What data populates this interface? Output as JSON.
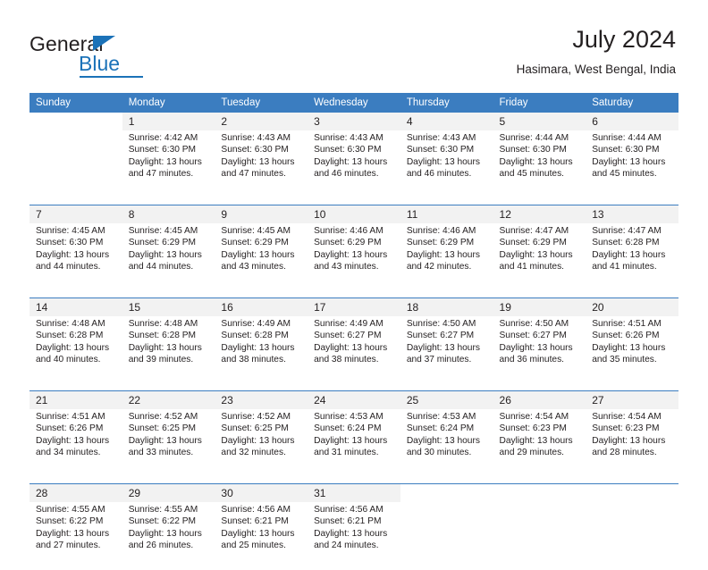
{
  "brand": {
    "name_dark": "General",
    "name_blue": "Blue",
    "accent_color": "#1b72b8"
  },
  "header": {
    "title": "July 2024",
    "subtitle": "Hasimara, West Bengal, India"
  },
  "calendar": {
    "header_bg": "#3b7dc0",
    "daynum_bg": "#f2f2f2",
    "weekdays": [
      "Sunday",
      "Monday",
      "Tuesday",
      "Wednesday",
      "Thursday",
      "Friday",
      "Saturday"
    ],
    "weeks": [
      [
        {
          "day": "",
          "sunrise": "",
          "sunset": "",
          "daylight_1": "",
          "daylight_2": ""
        },
        {
          "day": "1",
          "sunrise": "Sunrise: 4:42 AM",
          "sunset": "Sunset: 6:30 PM",
          "daylight_1": "Daylight: 13 hours",
          "daylight_2": "and 47 minutes."
        },
        {
          "day": "2",
          "sunrise": "Sunrise: 4:43 AM",
          "sunset": "Sunset: 6:30 PM",
          "daylight_1": "Daylight: 13 hours",
          "daylight_2": "and 47 minutes."
        },
        {
          "day": "3",
          "sunrise": "Sunrise: 4:43 AM",
          "sunset": "Sunset: 6:30 PM",
          "daylight_1": "Daylight: 13 hours",
          "daylight_2": "and 46 minutes."
        },
        {
          "day": "4",
          "sunrise": "Sunrise: 4:43 AM",
          "sunset": "Sunset: 6:30 PM",
          "daylight_1": "Daylight: 13 hours",
          "daylight_2": "and 46 minutes."
        },
        {
          "day": "5",
          "sunrise": "Sunrise: 4:44 AM",
          "sunset": "Sunset: 6:30 PM",
          "daylight_1": "Daylight: 13 hours",
          "daylight_2": "and 45 minutes."
        },
        {
          "day": "6",
          "sunrise": "Sunrise: 4:44 AM",
          "sunset": "Sunset: 6:30 PM",
          "daylight_1": "Daylight: 13 hours",
          "daylight_2": "and 45 minutes."
        }
      ],
      [
        {
          "day": "7",
          "sunrise": "Sunrise: 4:45 AM",
          "sunset": "Sunset: 6:30 PM",
          "daylight_1": "Daylight: 13 hours",
          "daylight_2": "and 44 minutes."
        },
        {
          "day": "8",
          "sunrise": "Sunrise: 4:45 AM",
          "sunset": "Sunset: 6:29 PM",
          "daylight_1": "Daylight: 13 hours",
          "daylight_2": "and 44 minutes."
        },
        {
          "day": "9",
          "sunrise": "Sunrise: 4:45 AM",
          "sunset": "Sunset: 6:29 PM",
          "daylight_1": "Daylight: 13 hours",
          "daylight_2": "and 43 minutes."
        },
        {
          "day": "10",
          "sunrise": "Sunrise: 4:46 AM",
          "sunset": "Sunset: 6:29 PM",
          "daylight_1": "Daylight: 13 hours",
          "daylight_2": "and 43 minutes."
        },
        {
          "day": "11",
          "sunrise": "Sunrise: 4:46 AM",
          "sunset": "Sunset: 6:29 PM",
          "daylight_1": "Daylight: 13 hours",
          "daylight_2": "and 42 minutes."
        },
        {
          "day": "12",
          "sunrise": "Sunrise: 4:47 AM",
          "sunset": "Sunset: 6:29 PM",
          "daylight_1": "Daylight: 13 hours",
          "daylight_2": "and 41 minutes."
        },
        {
          "day": "13",
          "sunrise": "Sunrise: 4:47 AM",
          "sunset": "Sunset: 6:28 PM",
          "daylight_1": "Daylight: 13 hours",
          "daylight_2": "and 41 minutes."
        }
      ],
      [
        {
          "day": "14",
          "sunrise": "Sunrise: 4:48 AM",
          "sunset": "Sunset: 6:28 PM",
          "daylight_1": "Daylight: 13 hours",
          "daylight_2": "and 40 minutes."
        },
        {
          "day": "15",
          "sunrise": "Sunrise: 4:48 AM",
          "sunset": "Sunset: 6:28 PM",
          "daylight_1": "Daylight: 13 hours",
          "daylight_2": "and 39 minutes."
        },
        {
          "day": "16",
          "sunrise": "Sunrise: 4:49 AM",
          "sunset": "Sunset: 6:28 PM",
          "daylight_1": "Daylight: 13 hours",
          "daylight_2": "and 38 minutes."
        },
        {
          "day": "17",
          "sunrise": "Sunrise: 4:49 AM",
          "sunset": "Sunset: 6:27 PM",
          "daylight_1": "Daylight: 13 hours",
          "daylight_2": "and 38 minutes."
        },
        {
          "day": "18",
          "sunrise": "Sunrise: 4:50 AM",
          "sunset": "Sunset: 6:27 PM",
          "daylight_1": "Daylight: 13 hours",
          "daylight_2": "and 37 minutes."
        },
        {
          "day": "19",
          "sunrise": "Sunrise: 4:50 AM",
          "sunset": "Sunset: 6:27 PM",
          "daylight_1": "Daylight: 13 hours",
          "daylight_2": "and 36 minutes."
        },
        {
          "day": "20",
          "sunrise": "Sunrise: 4:51 AM",
          "sunset": "Sunset: 6:26 PM",
          "daylight_1": "Daylight: 13 hours",
          "daylight_2": "and 35 minutes."
        }
      ],
      [
        {
          "day": "21",
          "sunrise": "Sunrise: 4:51 AM",
          "sunset": "Sunset: 6:26 PM",
          "daylight_1": "Daylight: 13 hours",
          "daylight_2": "and 34 minutes."
        },
        {
          "day": "22",
          "sunrise": "Sunrise: 4:52 AM",
          "sunset": "Sunset: 6:25 PM",
          "daylight_1": "Daylight: 13 hours",
          "daylight_2": "and 33 minutes."
        },
        {
          "day": "23",
          "sunrise": "Sunrise: 4:52 AM",
          "sunset": "Sunset: 6:25 PM",
          "daylight_1": "Daylight: 13 hours",
          "daylight_2": "and 32 minutes."
        },
        {
          "day": "24",
          "sunrise": "Sunrise: 4:53 AM",
          "sunset": "Sunset: 6:24 PM",
          "daylight_1": "Daylight: 13 hours",
          "daylight_2": "and 31 minutes."
        },
        {
          "day": "25",
          "sunrise": "Sunrise: 4:53 AM",
          "sunset": "Sunset: 6:24 PM",
          "daylight_1": "Daylight: 13 hours",
          "daylight_2": "and 30 minutes."
        },
        {
          "day": "26",
          "sunrise": "Sunrise: 4:54 AM",
          "sunset": "Sunset: 6:23 PM",
          "daylight_1": "Daylight: 13 hours",
          "daylight_2": "and 29 minutes."
        },
        {
          "day": "27",
          "sunrise": "Sunrise: 4:54 AM",
          "sunset": "Sunset: 6:23 PM",
          "daylight_1": "Daylight: 13 hours",
          "daylight_2": "and 28 minutes."
        }
      ],
      [
        {
          "day": "28",
          "sunrise": "Sunrise: 4:55 AM",
          "sunset": "Sunset: 6:22 PM",
          "daylight_1": "Daylight: 13 hours",
          "daylight_2": "and 27 minutes."
        },
        {
          "day": "29",
          "sunrise": "Sunrise: 4:55 AM",
          "sunset": "Sunset: 6:22 PM",
          "daylight_1": "Daylight: 13 hours",
          "daylight_2": "and 26 minutes."
        },
        {
          "day": "30",
          "sunrise": "Sunrise: 4:56 AM",
          "sunset": "Sunset: 6:21 PM",
          "daylight_1": "Daylight: 13 hours",
          "daylight_2": "and 25 minutes."
        },
        {
          "day": "31",
          "sunrise": "Sunrise: 4:56 AM",
          "sunset": "Sunset: 6:21 PM",
          "daylight_1": "Daylight: 13 hours",
          "daylight_2": "and 24 minutes."
        },
        {
          "day": "",
          "sunrise": "",
          "sunset": "",
          "daylight_1": "",
          "daylight_2": ""
        },
        {
          "day": "",
          "sunrise": "",
          "sunset": "",
          "daylight_1": "",
          "daylight_2": ""
        },
        {
          "day": "",
          "sunrise": "",
          "sunset": "",
          "daylight_1": "",
          "daylight_2": ""
        }
      ]
    ]
  }
}
